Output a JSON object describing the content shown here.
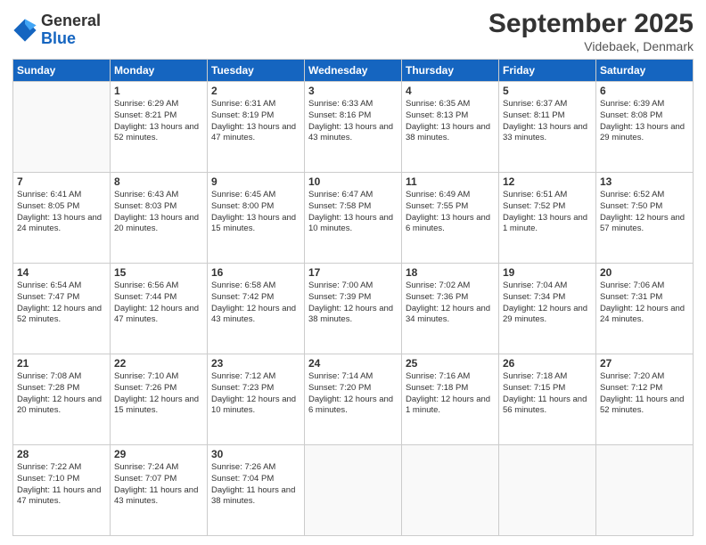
{
  "logo": {
    "general": "General",
    "blue": "Blue"
  },
  "title": "September 2025",
  "location": "Videbaek, Denmark",
  "days_of_week": [
    "Sunday",
    "Monday",
    "Tuesday",
    "Wednesday",
    "Thursday",
    "Friday",
    "Saturday"
  ],
  "weeks": [
    [
      {
        "day": "",
        "sunrise": "",
        "sunset": "",
        "daylight": ""
      },
      {
        "day": "1",
        "sunrise": "Sunrise: 6:29 AM",
        "sunset": "Sunset: 8:21 PM",
        "daylight": "Daylight: 13 hours and 52 minutes."
      },
      {
        "day": "2",
        "sunrise": "Sunrise: 6:31 AM",
        "sunset": "Sunset: 8:19 PM",
        "daylight": "Daylight: 13 hours and 47 minutes."
      },
      {
        "day": "3",
        "sunrise": "Sunrise: 6:33 AM",
        "sunset": "Sunset: 8:16 PM",
        "daylight": "Daylight: 13 hours and 43 minutes."
      },
      {
        "day": "4",
        "sunrise": "Sunrise: 6:35 AM",
        "sunset": "Sunset: 8:13 PM",
        "daylight": "Daylight: 13 hours and 38 minutes."
      },
      {
        "day": "5",
        "sunrise": "Sunrise: 6:37 AM",
        "sunset": "Sunset: 8:11 PM",
        "daylight": "Daylight: 13 hours and 33 minutes."
      },
      {
        "day": "6",
        "sunrise": "Sunrise: 6:39 AM",
        "sunset": "Sunset: 8:08 PM",
        "daylight": "Daylight: 13 hours and 29 minutes."
      }
    ],
    [
      {
        "day": "7",
        "sunrise": "Sunrise: 6:41 AM",
        "sunset": "Sunset: 8:05 PM",
        "daylight": "Daylight: 13 hours and 24 minutes."
      },
      {
        "day": "8",
        "sunrise": "Sunrise: 6:43 AM",
        "sunset": "Sunset: 8:03 PM",
        "daylight": "Daylight: 13 hours and 20 minutes."
      },
      {
        "day": "9",
        "sunrise": "Sunrise: 6:45 AM",
        "sunset": "Sunset: 8:00 PM",
        "daylight": "Daylight: 13 hours and 15 minutes."
      },
      {
        "day": "10",
        "sunrise": "Sunrise: 6:47 AM",
        "sunset": "Sunset: 7:58 PM",
        "daylight": "Daylight: 13 hours and 10 minutes."
      },
      {
        "day": "11",
        "sunrise": "Sunrise: 6:49 AM",
        "sunset": "Sunset: 7:55 PM",
        "daylight": "Daylight: 13 hours and 6 minutes."
      },
      {
        "day": "12",
        "sunrise": "Sunrise: 6:51 AM",
        "sunset": "Sunset: 7:52 PM",
        "daylight": "Daylight: 13 hours and 1 minute."
      },
      {
        "day": "13",
        "sunrise": "Sunrise: 6:52 AM",
        "sunset": "Sunset: 7:50 PM",
        "daylight": "Daylight: 12 hours and 57 minutes."
      }
    ],
    [
      {
        "day": "14",
        "sunrise": "Sunrise: 6:54 AM",
        "sunset": "Sunset: 7:47 PM",
        "daylight": "Daylight: 12 hours and 52 minutes."
      },
      {
        "day": "15",
        "sunrise": "Sunrise: 6:56 AM",
        "sunset": "Sunset: 7:44 PM",
        "daylight": "Daylight: 12 hours and 47 minutes."
      },
      {
        "day": "16",
        "sunrise": "Sunrise: 6:58 AM",
        "sunset": "Sunset: 7:42 PM",
        "daylight": "Daylight: 12 hours and 43 minutes."
      },
      {
        "day": "17",
        "sunrise": "Sunrise: 7:00 AM",
        "sunset": "Sunset: 7:39 PM",
        "daylight": "Daylight: 12 hours and 38 minutes."
      },
      {
        "day": "18",
        "sunrise": "Sunrise: 7:02 AM",
        "sunset": "Sunset: 7:36 PM",
        "daylight": "Daylight: 12 hours and 34 minutes."
      },
      {
        "day": "19",
        "sunrise": "Sunrise: 7:04 AM",
        "sunset": "Sunset: 7:34 PM",
        "daylight": "Daylight: 12 hours and 29 minutes."
      },
      {
        "day": "20",
        "sunrise": "Sunrise: 7:06 AM",
        "sunset": "Sunset: 7:31 PM",
        "daylight": "Daylight: 12 hours and 24 minutes."
      }
    ],
    [
      {
        "day": "21",
        "sunrise": "Sunrise: 7:08 AM",
        "sunset": "Sunset: 7:28 PM",
        "daylight": "Daylight: 12 hours and 20 minutes."
      },
      {
        "day": "22",
        "sunrise": "Sunrise: 7:10 AM",
        "sunset": "Sunset: 7:26 PM",
        "daylight": "Daylight: 12 hours and 15 minutes."
      },
      {
        "day": "23",
        "sunrise": "Sunrise: 7:12 AM",
        "sunset": "Sunset: 7:23 PM",
        "daylight": "Daylight: 12 hours and 10 minutes."
      },
      {
        "day": "24",
        "sunrise": "Sunrise: 7:14 AM",
        "sunset": "Sunset: 7:20 PM",
        "daylight": "Daylight: 12 hours and 6 minutes."
      },
      {
        "day": "25",
        "sunrise": "Sunrise: 7:16 AM",
        "sunset": "Sunset: 7:18 PM",
        "daylight": "Daylight: 12 hours and 1 minute."
      },
      {
        "day": "26",
        "sunrise": "Sunrise: 7:18 AM",
        "sunset": "Sunset: 7:15 PM",
        "daylight": "Daylight: 11 hours and 56 minutes."
      },
      {
        "day": "27",
        "sunrise": "Sunrise: 7:20 AM",
        "sunset": "Sunset: 7:12 PM",
        "daylight": "Daylight: 11 hours and 52 minutes."
      }
    ],
    [
      {
        "day": "28",
        "sunrise": "Sunrise: 7:22 AM",
        "sunset": "Sunset: 7:10 PM",
        "daylight": "Daylight: 11 hours and 47 minutes."
      },
      {
        "day": "29",
        "sunrise": "Sunrise: 7:24 AM",
        "sunset": "Sunset: 7:07 PM",
        "daylight": "Daylight: 11 hours and 43 minutes."
      },
      {
        "day": "30",
        "sunrise": "Sunrise: 7:26 AM",
        "sunset": "Sunset: 7:04 PM",
        "daylight": "Daylight: 11 hours and 38 minutes."
      },
      {
        "day": "",
        "sunrise": "",
        "sunset": "",
        "daylight": ""
      },
      {
        "day": "",
        "sunrise": "",
        "sunset": "",
        "daylight": ""
      },
      {
        "day": "",
        "sunrise": "",
        "sunset": "",
        "daylight": ""
      },
      {
        "day": "",
        "sunrise": "",
        "sunset": "",
        "daylight": ""
      }
    ]
  ]
}
